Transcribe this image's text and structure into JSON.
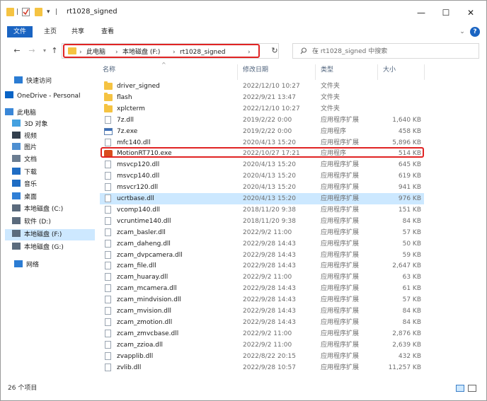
{
  "window": {
    "title": "rt1028_signed",
    "quick_access": {
      "separator": "|",
      "dropdown": "▾"
    },
    "controls": {
      "minimize": "—",
      "maximize": "☐",
      "close": "✕"
    }
  },
  "ribbon": {
    "tabs": [
      {
        "label": "文件"
      },
      {
        "label": "主页"
      },
      {
        "label": "共享"
      },
      {
        "label": "查看"
      }
    ],
    "expand_glyph": "⌄",
    "help_glyph": "?"
  },
  "navigation": {
    "back": "←",
    "forward": "→",
    "history": "▾",
    "up": "↑",
    "breadcrumb": [
      "此电脑",
      "本地磁盘 (F:)",
      "rt1028_signed"
    ],
    "separator": "›",
    "dropdown": "⌄",
    "refresh": "↻",
    "search_placeholder": "在 rt1028_signed 中搜索"
  },
  "sidebar": {
    "items": [
      {
        "label": "快速访问",
        "icon": "star-icon",
        "color": "#2b7cd3"
      },
      {
        "label": "OneDrive - Personal",
        "icon": "cloud-icon",
        "color": "#0a64c6"
      },
      {
        "label": "此电脑",
        "icon": "computer-icon",
        "color": "#3a87d8"
      },
      {
        "label": "3D 对象",
        "icon": "cube-icon",
        "color": "#45a1e0"
      },
      {
        "label": "视频",
        "icon": "video-icon",
        "color": "#333f4d"
      },
      {
        "label": "图片",
        "icon": "picture-icon",
        "color": "#4e8fd1"
      },
      {
        "label": "文档",
        "icon": "document-icon",
        "color": "#6b7d91"
      },
      {
        "label": "下载",
        "icon": "download-icon",
        "color": "#1f6dc4"
      },
      {
        "label": "音乐",
        "icon": "music-icon",
        "color": "#1f6dc4"
      },
      {
        "label": "桌面",
        "icon": "desktop-icon",
        "color": "#2f7fd6"
      },
      {
        "label": "本地磁盘 (C:)",
        "icon": "drive-c-icon",
        "color": "#5b6b7d"
      },
      {
        "label": "软件 (D:)",
        "icon": "drive-icon",
        "color": "#5b6b7d"
      },
      {
        "label": "本地磁盘 (F:)",
        "icon": "drive-icon",
        "color": "#5b6b7d"
      },
      {
        "label": "本地磁盘 (G:)",
        "icon": "drive-icon",
        "color": "#5b6b7d"
      },
      {
        "label": "网络",
        "icon": "network-icon",
        "color": "#2b7cd3"
      }
    ]
  },
  "columns": {
    "name": "名称",
    "date": "修改日期",
    "type": "类型",
    "size": "大小",
    "sort_glyph": "^"
  },
  "files": [
    {
      "name": "driver_signed",
      "date": "2022/12/10 10:27",
      "type": "文件夹",
      "size": "",
      "icon": "folder"
    },
    {
      "name": "flash",
      "date": "2022/9/21 13:47",
      "type": "文件夹",
      "size": "",
      "icon": "folder"
    },
    {
      "name": "xplcterm",
      "date": "2022/12/10 10:27",
      "type": "文件夹",
      "size": "",
      "icon": "folder"
    },
    {
      "name": "7z.dll",
      "date": "2019/2/22 0:00",
      "type": "应用程序扩展",
      "size": "1,640 KB",
      "icon": "dll"
    },
    {
      "name": "7z.exe",
      "date": "2019/2/22 0:00",
      "type": "应用程序",
      "size": "458 KB",
      "icon": "exe"
    },
    {
      "name": "mfc140.dll",
      "date": "2020/4/13 15:20",
      "type": "应用程序扩展",
      "size": "5,896 KB",
      "icon": "dll"
    },
    {
      "name": "MotionRT710.exe",
      "date": "2022/10/27 17:21",
      "type": "应用程序",
      "size": "514 KB",
      "icon": "motion"
    },
    {
      "name": "msvcp120.dll",
      "date": "2020/4/13 15:20",
      "type": "应用程序扩展",
      "size": "645 KB",
      "icon": "dll"
    },
    {
      "name": "msvcp140.dll",
      "date": "2020/4/13 15:20",
      "type": "应用程序扩展",
      "size": "619 KB",
      "icon": "dll"
    },
    {
      "name": "msvcr120.dll",
      "date": "2020/4/13 15:20",
      "type": "应用程序扩展",
      "size": "941 KB",
      "icon": "dll"
    },
    {
      "name": "ucrtbase.dll",
      "date": "2020/4/13 15:20",
      "type": "应用程序扩展",
      "size": "976 KB",
      "icon": "dll"
    },
    {
      "name": "vcomp140.dll",
      "date": "2018/11/20 9:38",
      "type": "应用程序扩展",
      "size": "151 KB",
      "icon": "dll"
    },
    {
      "name": "vcruntime140.dll",
      "date": "2018/11/20 9:38",
      "type": "应用程序扩展",
      "size": "84 KB",
      "icon": "dll"
    },
    {
      "name": "zcam_basler.dll",
      "date": "2022/9/2 11:00",
      "type": "应用程序扩展",
      "size": "57 KB",
      "icon": "dll"
    },
    {
      "name": "zcam_daheng.dll",
      "date": "2022/9/28 14:43",
      "type": "应用程序扩展",
      "size": "50 KB",
      "icon": "dll"
    },
    {
      "name": "zcam_dvpcamera.dll",
      "date": "2022/9/28 14:43",
      "type": "应用程序扩展",
      "size": "59 KB",
      "icon": "dll"
    },
    {
      "name": "zcam_file.dll",
      "date": "2022/9/28 14:43",
      "type": "应用程序扩展",
      "size": "2,647 KB",
      "icon": "dll"
    },
    {
      "name": "zcam_huaray.dll",
      "date": "2022/9/2 11:00",
      "type": "应用程序扩展",
      "size": "63 KB",
      "icon": "dll"
    },
    {
      "name": "zcam_mcamera.dll",
      "date": "2022/9/28 14:43",
      "type": "应用程序扩展",
      "size": "61 KB",
      "icon": "dll"
    },
    {
      "name": "zcam_mindvision.dll",
      "date": "2022/9/28 14:43",
      "type": "应用程序扩展",
      "size": "57 KB",
      "icon": "dll"
    },
    {
      "name": "zcam_mvision.dll",
      "date": "2022/9/28 14:43",
      "type": "应用程序扩展",
      "size": "84 KB",
      "icon": "dll"
    },
    {
      "name": "zcam_zmotion.dll",
      "date": "2022/9/28 14:43",
      "type": "应用程序扩展",
      "size": "84 KB",
      "icon": "dll"
    },
    {
      "name": "zcam_zmvcbase.dll",
      "date": "2022/9/2 11:00",
      "type": "应用程序扩展",
      "size": "2,876 KB",
      "icon": "dll"
    },
    {
      "name": "zcam_zzioa.dll",
      "date": "2022/9/2 11:00",
      "type": "应用程序扩展",
      "size": "2,639 KB",
      "icon": "dll"
    },
    {
      "name": "zvapplib.dll",
      "date": "2022/8/22 20:15",
      "type": "应用程序扩展",
      "size": "432 KB",
      "icon": "dll"
    },
    {
      "name": "zvlib.dll",
      "date": "2022/9/28 10:57",
      "type": "应用程序扩展",
      "size": "11,257 KB",
      "icon": "dll"
    }
  ],
  "status": {
    "count": "26 个项目"
  },
  "colors": {
    "accent": "#1a64c2",
    "highlight": "#e02424",
    "selection": "#cce8ff"
  }
}
